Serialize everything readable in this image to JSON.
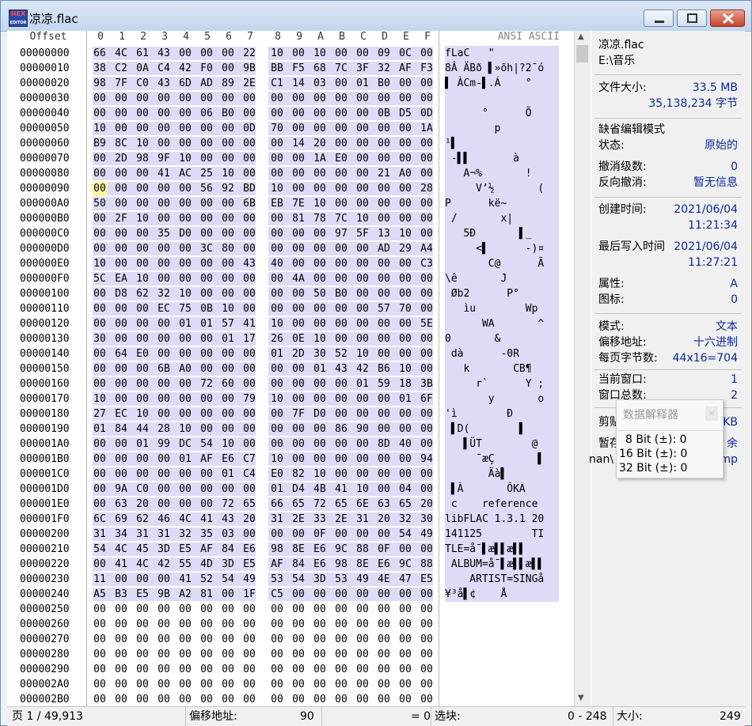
{
  "window": {
    "title": "凉凉.flac",
    "icon_top": "HEX",
    "icon_bottom": "EDITOR"
  },
  "header": {
    "offset": "Offset",
    "cols": [
      "0",
      "1",
      "2",
      "3",
      "4",
      "5",
      "6",
      "7",
      "8",
      "9",
      "A",
      "B",
      "C",
      "D",
      "E",
      "F"
    ],
    "ansi": "ANSI ASCII"
  },
  "rows": [
    {
      "a": "00000000",
      "h": [
        "66",
        "4C",
        "61",
        "43",
        "00",
        "00",
        "00",
        "22",
        "10",
        "00",
        "10",
        "00",
        "00",
        "09",
        "0C",
        "00"
      ],
      "t": "fLaC   \"        "
    },
    {
      "a": "00000010",
      "h": [
        "38",
        "C2",
        "0A",
        "C4",
        "42",
        "F0",
        "00",
        "9B",
        "BB",
        "F5",
        "68",
        "7C",
        "3F",
        "32",
        "AF",
        "F3"
      ],
      "t": "8Â ÄBð ▌»õh|?2¯ó"
    },
    {
      "a": "00000020",
      "h": [
        "98",
        "7F",
        "C0",
        "43",
        "6D",
        "AD",
        "89",
        "2E",
        "C1",
        "14",
        "03",
        "00",
        "01",
        "B0",
        "00",
        "00"
      ],
      "t": "▌ ÀCm-▌.Á    °  "
    },
    {
      "a": "00000030",
      "h": [
        "00",
        "00",
        "00",
        "00",
        "00",
        "00",
        "00",
        "00",
        "00",
        "00",
        "00",
        "00",
        "00",
        "00",
        "00",
        "00"
      ],
      "t": "                "
    },
    {
      "a": "00000040",
      "h": [
        "00",
        "00",
        "00",
        "00",
        "00",
        "06",
        "B0",
        "00",
        "00",
        "00",
        "00",
        "00",
        "00",
        "0B",
        "D5",
        "0D"
      ],
      "t": "      °      Õ  "
    },
    {
      "a": "00000050",
      "h": [
        "10",
        "00",
        "00",
        "00",
        "00",
        "00",
        "00",
        "0D",
        "70",
        "00",
        "00",
        "00",
        "00",
        "00",
        "00",
        "1A"
      ],
      "t": "        p       "
    },
    {
      "a": "00000060",
      "h": [
        "B9",
        "8C",
        "10",
        "00",
        "00",
        "00",
        "00",
        "00",
        "00",
        "14",
        "20",
        "00",
        "00",
        "00",
        "00",
        "00"
      ],
      "t": "¹▌              "
    },
    {
      "a": "00000070",
      "h": [
        "00",
        "2D",
        "98",
        "9F",
        "10",
        "00",
        "00",
        "00",
        "00",
        "00",
        "1A",
        "E0",
        "00",
        "00",
        "00",
        "00"
      ],
      "t": " -▌▌       à    "
    },
    {
      "a": "00000080",
      "h": [
        "00",
        "00",
        "00",
        "41",
        "AC",
        "25",
        "10",
        "00",
        "00",
        "00",
        "00",
        "00",
        "00",
        "21",
        "A0",
        "00"
      ],
      "t": "   A¬%       !  "
    },
    {
      "a": "00000090",
      "h": [
        "00",
        "00",
        "00",
        "00",
        "00",
        "56",
        "92",
        "BD",
        "10",
        "00",
        "00",
        "00",
        "00",
        "00",
        "00",
        "28"
      ],
      "t": "     V’½       ("
    },
    {
      "a": "000000A0",
      "h": [
        "50",
        "00",
        "00",
        "00",
        "00",
        "00",
        "00",
        "6B",
        "EB",
        "7E",
        "10",
        "00",
        "00",
        "00",
        "00",
        "00"
      ],
      "t": "P      kë~      "
    },
    {
      "a": "000000B0",
      "h": [
        "00",
        "2F",
        "10",
        "00",
        "00",
        "00",
        "00",
        "00",
        "00",
        "81",
        "78",
        "7C",
        "10",
        "00",
        "00",
        "00"
      ],
      "t": " /       x|     "
    },
    {
      "a": "000000C0",
      "h": [
        "00",
        "00",
        "00",
        "35",
        "D0",
        "00",
        "00",
        "00",
        "00",
        "00",
        "00",
        "97",
        "5F",
        "13",
        "10",
        "00"
      ],
      "t": "   5Ð       ▌_  "
    },
    {
      "a": "000000D0",
      "h": [
        "00",
        "00",
        "00",
        "00",
        "00",
        "3C",
        "80",
        "00",
        "00",
        "00",
        "00",
        "00",
        "00",
        "AD",
        "29",
        "A4"
      ],
      "t": "     <▌      -)¤"
    },
    {
      "a": "000000E0",
      "h": [
        "10",
        "00",
        "00",
        "00",
        "00",
        "00",
        "00",
        "43",
        "40",
        "00",
        "00",
        "00",
        "00",
        "00",
        "00",
        "C3"
      ],
      "t": "       C@      Ã"
    },
    {
      "a": "000000F0",
      "h": [
        "5C",
        "EA",
        "10",
        "00",
        "00",
        "00",
        "00",
        "00",
        "00",
        "4A",
        "00",
        "00",
        "00",
        "00",
        "00",
        "00"
      ],
      "t": "\\ê       J      "
    },
    {
      "a": "00000100",
      "h": [
        "00",
        "D8",
        "62",
        "32",
        "10",
        "00",
        "00",
        "00",
        "00",
        "00",
        "50",
        "B0",
        "00",
        "00",
        "00",
        "00"
      ],
      "t": " Øb2      P°    "
    },
    {
      "a": "00000110",
      "h": [
        "00",
        "00",
        "00",
        "EC",
        "75",
        "0B",
        "10",
        "00",
        "00",
        "00",
        "00",
        "00",
        "00",
        "57",
        "70",
        "00"
      ],
      "t": "   ìu        Wp "
    },
    {
      "a": "00000120",
      "h": [
        "00",
        "00",
        "00",
        "00",
        "01",
        "01",
        "57",
        "41",
        "10",
        "00",
        "00",
        "00",
        "00",
        "00",
        "00",
        "5E"
      ],
      "t": "      WA       ^"
    },
    {
      "a": "00000130",
      "h": [
        "30",
        "00",
        "00",
        "00",
        "00",
        "00",
        "01",
        "17",
        "26",
        "0E",
        "10",
        "00",
        "00",
        "00",
        "00",
        "00"
      ],
      "t": "0       &       "
    },
    {
      "a": "00000140",
      "h": [
        "00",
        "64",
        "E0",
        "00",
        "00",
        "00",
        "00",
        "00",
        "01",
        "2D",
        "30",
        "52",
        "10",
        "00",
        "00",
        "00"
      ],
      "t": " dà      -0R    "
    },
    {
      "a": "00000150",
      "h": [
        "00",
        "00",
        "00",
        "6B",
        "A0",
        "00",
        "00",
        "00",
        "00",
        "00",
        "01",
        "43",
        "42",
        "B6",
        "10",
        "00"
      ],
      "t": "   k       CB¶  "
    },
    {
      "a": "00000160",
      "h": [
        "00",
        "00",
        "00",
        "00",
        "00",
        "72",
        "60",
        "00",
        "00",
        "00",
        "00",
        "00",
        "01",
        "59",
        "18",
        "3B"
      ],
      "t": "     r`      Y ;"
    },
    {
      "a": "00000170",
      "h": [
        "10",
        "00",
        "00",
        "00",
        "00",
        "00",
        "00",
        "79",
        "10",
        "00",
        "00",
        "00",
        "00",
        "00",
        "01",
        "6F"
      ],
      "t": "       y       o"
    },
    {
      "a": "00000180",
      "h": [
        "27",
        "EC",
        "10",
        "00",
        "00",
        "00",
        "00",
        "00",
        "00",
        "7F",
        "D0",
        "00",
        "00",
        "00",
        "00",
        "00"
      ],
      "t": "'ì        Ð     "
    },
    {
      "a": "00000190",
      "h": [
        "01",
        "84",
        "44",
        "28",
        "10",
        "00",
        "00",
        "00",
        "00",
        "00",
        "00",
        "86",
        "90",
        "00",
        "00",
        "00"
      ],
      "t": " ▌D(        ▌   "
    },
    {
      "a": "000001A0",
      "h": [
        "00",
        "00",
        "01",
        "99",
        "DC",
        "54",
        "10",
        "00",
        "00",
        "00",
        "00",
        "00",
        "00",
        "8D",
        "40",
        "00"
      ],
      "t": "   ▌ÜT        @ "
    },
    {
      "a": "000001B0",
      "h": [
        "00",
        "00",
        "00",
        "00",
        "01",
        "AF",
        "E6",
        "C7",
        "10",
        "00",
        "00",
        "00",
        "00",
        "00",
        "00",
        "94"
      ],
      "t": "     ¯æÇ       ▌"
    },
    {
      "a": "000001C0",
      "h": [
        "00",
        "00",
        "00",
        "00",
        "00",
        "00",
        "01",
        "C4",
        "E0",
        "82",
        "10",
        "00",
        "00",
        "00",
        "00",
        "00"
      ],
      "t": "       Äà▌      "
    },
    {
      "a": "000001D0",
      "h": [
        "00",
        "9A",
        "C0",
        "00",
        "00",
        "00",
        "00",
        "00",
        "01",
        "D4",
        "4B",
        "41",
        "10",
        "00",
        "04",
        "00"
      ],
      "t": " ▌À       ÔKA    "
    },
    {
      "a": "000001E0",
      "h": [
        "00",
        "63",
        "20",
        "00",
        "00",
        "00",
        "72",
        "65",
        "66",
        "65",
        "72",
        "65",
        "6E",
        "63",
        "65",
        "20"
      ],
      "t": " c    reference "
    },
    {
      "a": "000001F0",
      "h": [
        "6C",
        "69",
        "62",
        "46",
        "4C",
        "41",
        "43",
        "20",
        "31",
        "2E",
        "33",
        "2E",
        "31",
        "20",
        "32",
        "30"
      ],
      "t": "libFLAC 1.3.1 20"
    },
    {
      "a": "00000200",
      "h": [
        "31",
        "34",
        "31",
        "31",
        "32",
        "35",
        "03",
        "00",
        "00",
        "00",
        "0F",
        "00",
        "00",
        "00",
        "54",
        "49"
      ],
      "t": "141125        TI"
    },
    {
      "a": "00000210",
      "h": [
        "54",
        "4C",
        "45",
        "3D",
        "E5",
        "AF",
        "84",
        "E6",
        "98",
        "8E",
        "E6",
        "9C",
        "88",
        "0F",
        "00",
        "00"
      ],
      "t": "TLE=å¯▌æ▌▌æ▌▌  "
    },
    {
      "a": "00000220",
      "h": [
        "00",
        "41",
        "4C",
        "42",
        "55",
        "4D",
        "3D",
        "E5",
        "AF",
        "84",
        "E6",
        "98",
        "8E",
        "E6",
        "9C",
        "88"
      ],
      "t": " ALBUM=å¯▌æ▌▌æ▌▌"
    },
    {
      "a": "00000230",
      "h": [
        "11",
        "00",
        "00",
        "00",
        "41",
        "52",
        "54",
        "49",
        "53",
        "54",
        "3D",
        "53",
        "49",
        "4E",
        "47",
        "E5"
      ],
      "t": "    ARTIST=SINGå"
    },
    {
      "a": "00000240",
      "h": [
        "A5",
        "B3",
        "E5",
        "9B",
        "A2",
        "81",
        "00",
        "1F",
        "C5",
        "00",
        "00",
        "00",
        "00",
        "00",
        "00",
        "00"
      ],
      "t": "¥³å▌¢    Å       "
    },
    {
      "a": "00000250",
      "h": [
        "00",
        "00",
        "00",
        "00",
        "00",
        "00",
        "00",
        "00",
        "00",
        "00",
        "00",
        "00",
        "00",
        "00",
        "00",
        "00"
      ],
      "t": ""
    },
    {
      "a": "00000260",
      "h": [
        "00",
        "00",
        "00",
        "00",
        "00",
        "00",
        "00",
        "00",
        "00",
        "00",
        "00",
        "00",
        "00",
        "00",
        "00",
        "00"
      ],
      "t": ""
    },
    {
      "a": "00000270",
      "h": [
        "00",
        "00",
        "00",
        "00",
        "00",
        "00",
        "00",
        "00",
        "00",
        "00",
        "00",
        "00",
        "00",
        "00",
        "00",
        "00"
      ],
      "t": ""
    },
    {
      "a": "00000280",
      "h": [
        "00",
        "00",
        "00",
        "00",
        "00",
        "00",
        "00",
        "00",
        "00",
        "00",
        "00",
        "00",
        "00",
        "00",
        "00",
        "00"
      ],
      "t": ""
    },
    {
      "a": "00000290",
      "h": [
        "00",
        "00",
        "00",
        "00",
        "00",
        "00",
        "00",
        "00",
        "00",
        "00",
        "00",
        "00",
        "00",
        "00",
        "00",
        "00"
      ],
      "t": ""
    },
    {
      "a": "000002A0",
      "h": [
        "00",
        "00",
        "00",
        "00",
        "00",
        "00",
        "00",
        "00",
        "00",
        "00",
        "00",
        "00",
        "00",
        "00",
        "00",
        "00"
      ],
      "t": ""
    },
    {
      "a": "000002B0",
      "h": [
        "00",
        "00",
        "00",
        "00",
        "00",
        "00",
        "00",
        "00",
        "00",
        "00",
        "00",
        "00",
        "00",
        "00",
        "00",
        "00"
      ],
      "t": ""
    }
  ],
  "panel": {
    "filename": "凉凉.flac",
    "path": "E:\\音乐",
    "filesize_label": "文件大小:",
    "filesize_mb": "33.5 MB",
    "filesize_bytes": "35,138,234 字节",
    "edit_mode": "缺省编辑模式",
    "status_label": "状态:",
    "status_value": "原始的",
    "undo_label": "撤消级数:",
    "undo_value": "0",
    "redo_label": "反向撤消:",
    "redo_value": "暂无信息",
    "created_label": "创建时间:",
    "created_date": "2021/06/04",
    "created_time": "11:21:34",
    "written_label": "最后写入时间",
    "written_date": "2021/06/04",
    "written_time": "11:27:21",
    "attr_label": "属性:",
    "attr_value": "A",
    "icon_label": "图标:",
    "icon_value": "0",
    "mode_label": "模式:",
    "mode_value": "文本",
    "offset_label": "偏移地址:",
    "offset_value": "十六进制",
    "bpp_label": "每页字节数:",
    "bpp_value": "44x16=704",
    "curwin_label": "当前窗口:",
    "curwin_value": "1",
    "totalwin_label": "窗口总数:",
    "totalwin_value": "2",
    "clip_label": "剪贴",
    "clip_value": "KB",
    "temp_label": "暂存",
    "temp_value": "余",
    "tmp_path": "nan\\",
    "tmp_ext": "mp"
  },
  "popup": {
    "title": "数据解释器",
    "close": "×",
    "lines": [
      "8 Bit (±): 0",
      "16 Bit (±): 0",
      "32 Bit (±): 0"
    ]
  },
  "status": {
    "page": "页 1 / 49,913",
    "offset_label": "偏移地址:",
    "offset_value": "90",
    "eq": "= 0",
    "sel_label": "选块:",
    "sel_value": "0 - 248",
    "size_label": "大小:",
    "size_value": "249"
  }
}
